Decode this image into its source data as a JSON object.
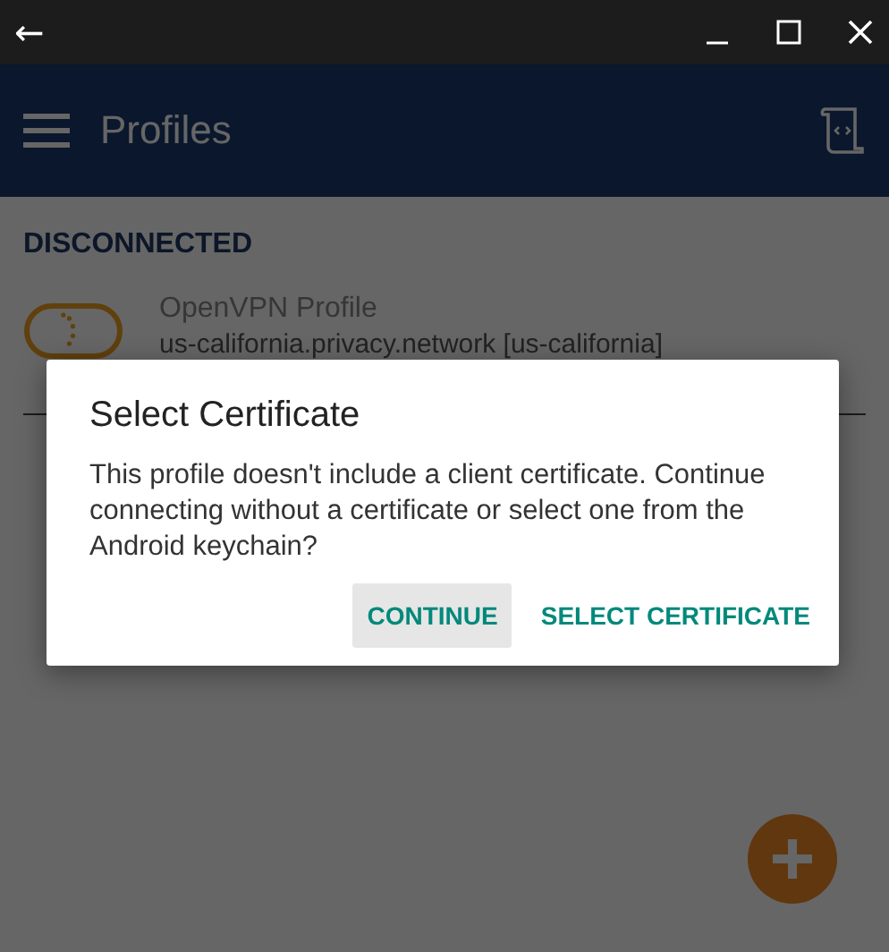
{
  "title_bar": {
    "back": "←"
  },
  "app_bar": {
    "title": "Profiles"
  },
  "status": "DISCONNECTED",
  "profiles": [
    {
      "name": "OpenVPN Profile",
      "server": "us-california.privacy.network [us-california]"
    }
  ],
  "dialog": {
    "title": "Select Certificate",
    "message": "This profile doesn't include a client certificate. Continue connecting without a certificate or select one from the Android keychain?",
    "buttons": [
      {
        "label": "CONTINUE",
        "selected": true
      },
      {
        "label": "SELECT CERTIFICATE",
        "selected": false
      }
    ]
  }
}
